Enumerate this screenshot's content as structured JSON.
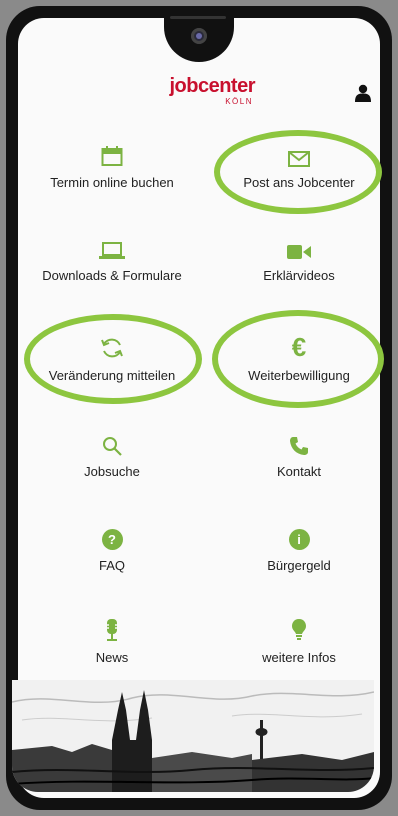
{
  "brand": {
    "name": "jobcenter",
    "city": "KÖLN"
  },
  "colors": {
    "accent": "#8dc63f",
    "brand": "#c8102e",
    "highlight": "#8dc63f"
  },
  "tiles": [
    {
      "label": "Termin online buchen",
      "icon": "calendar-icon"
    },
    {
      "label": "Post ans Jobcenter",
      "icon": "envelope-icon",
      "highlighted": true
    },
    {
      "label": "Downloads & Formulare",
      "icon": "laptop-icon"
    },
    {
      "label": "Erklärvideos",
      "icon": "video-camera-icon"
    },
    {
      "label": "Veränderung mitteilen",
      "icon": "refresh-icon",
      "highlighted": true
    },
    {
      "label": "Weiterbewilligung",
      "icon": "euro-icon",
      "highlighted": true
    },
    {
      "label": "Jobsuche",
      "icon": "search-icon"
    },
    {
      "label": "Kontakt",
      "icon": "phone-icon"
    },
    {
      "label": "FAQ",
      "icon": "question-icon",
      "glyph": "?"
    },
    {
      "label": "Bürgergeld",
      "icon": "info-icon",
      "glyph": "i"
    },
    {
      "label": "News",
      "icon": "microphone-icon"
    },
    {
      "label": "weitere Infos",
      "icon": "lightbulb-icon"
    }
  ]
}
